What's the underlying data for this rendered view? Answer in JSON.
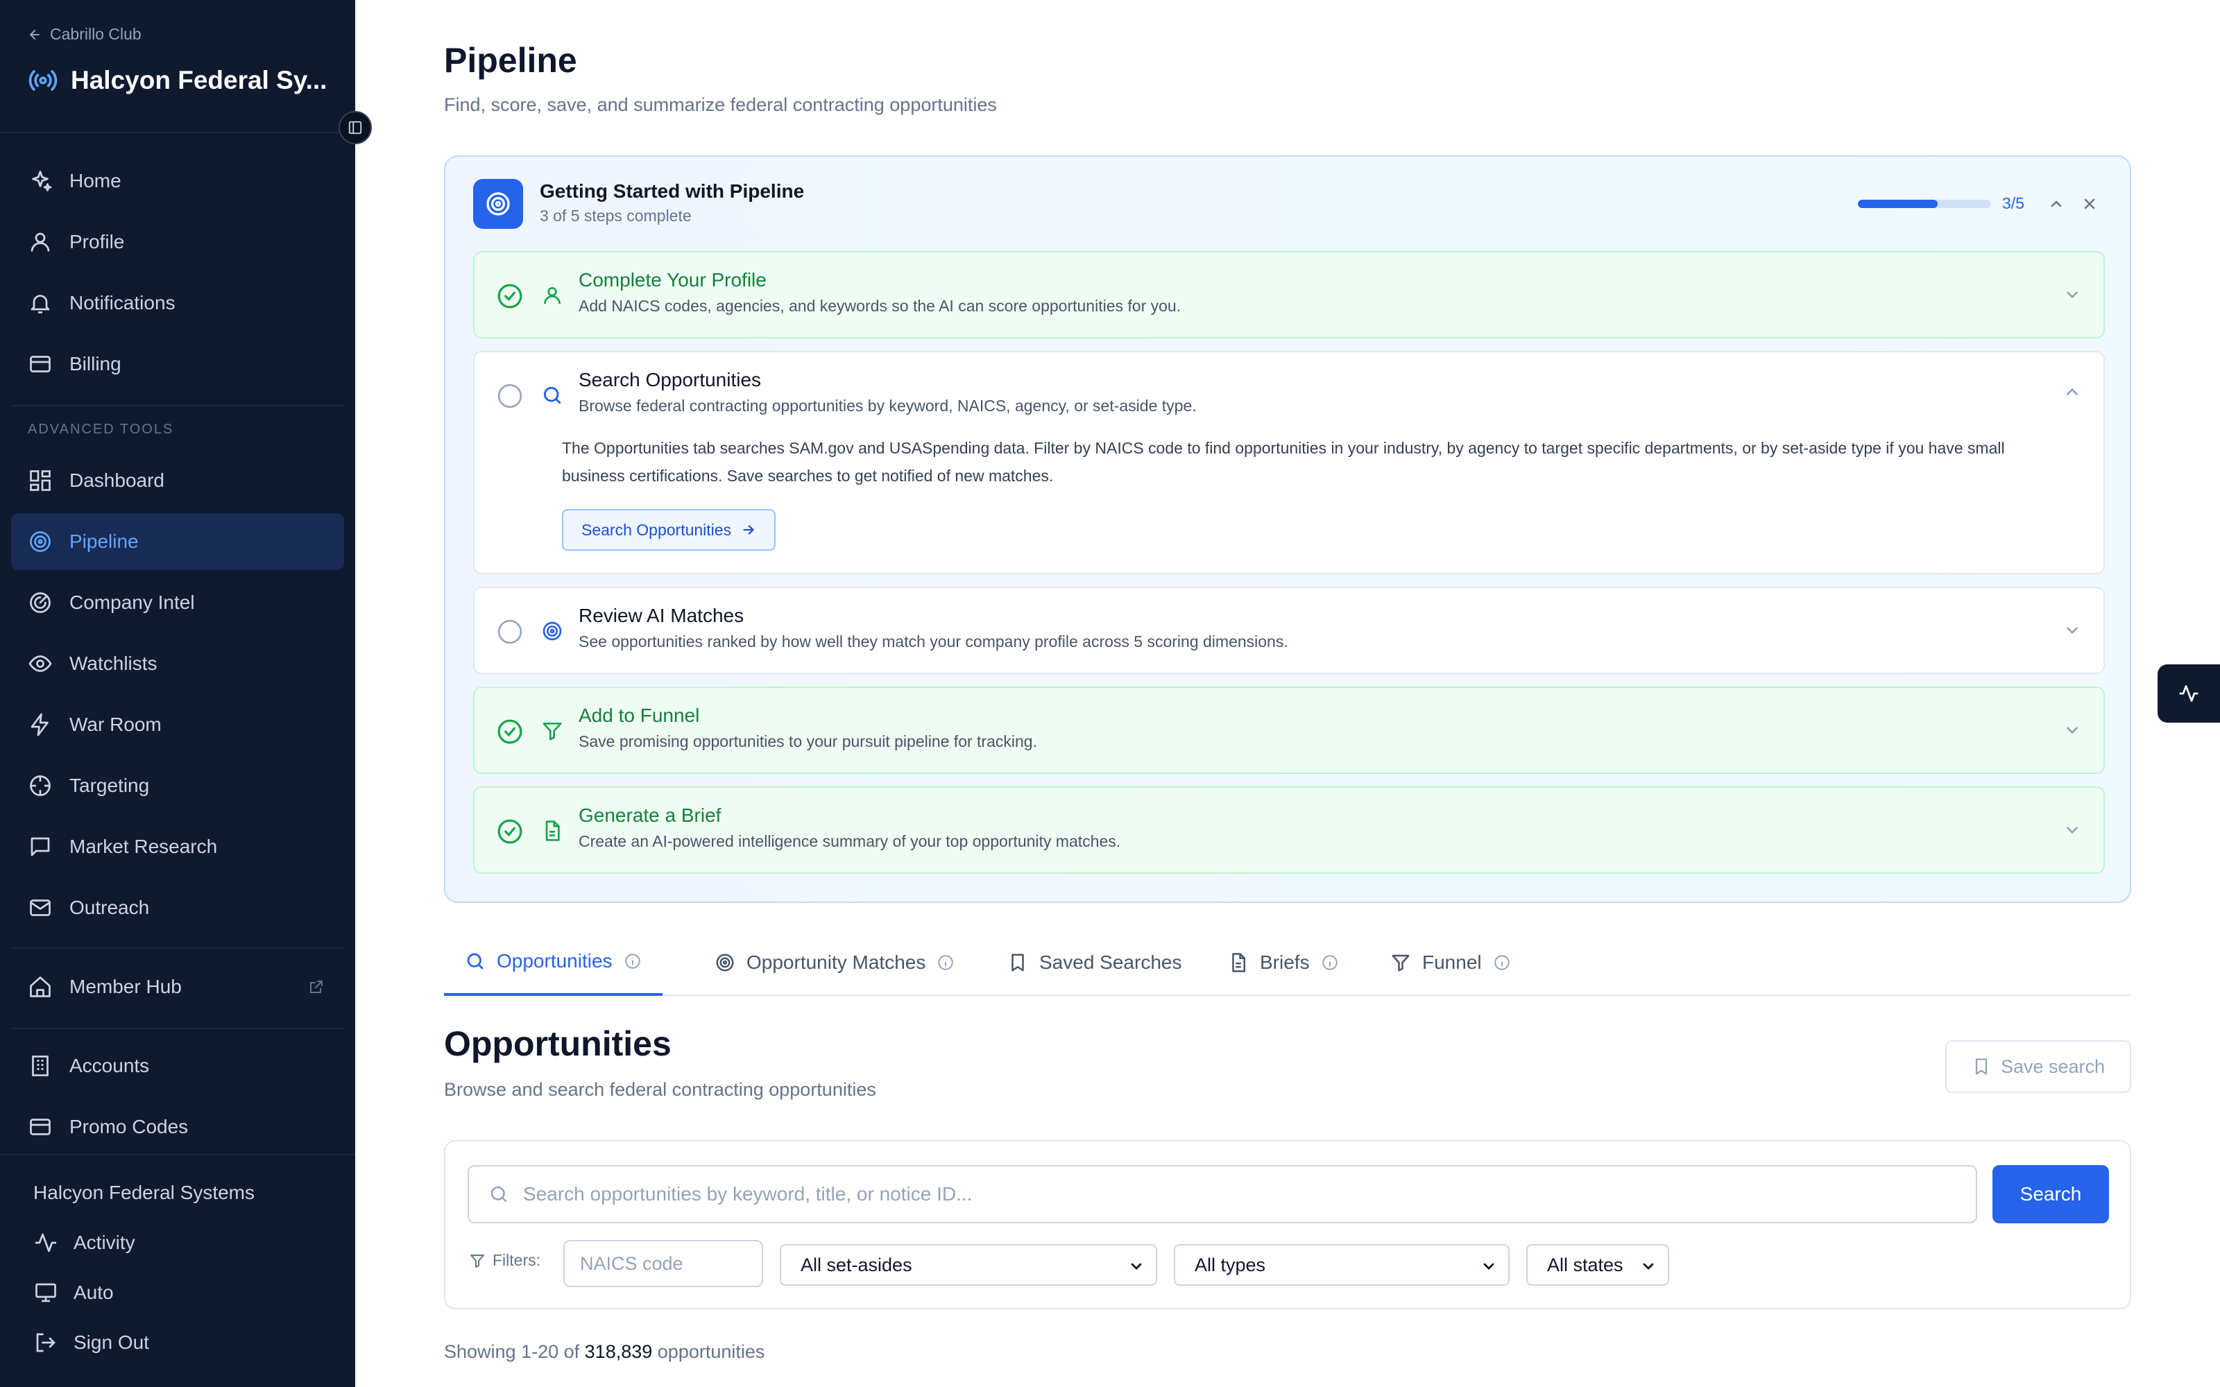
{
  "sidebar": {
    "back_label": "Cabrillo Club",
    "org_name": "Halcyon Federal Sy...",
    "primary": [
      {
        "label": "Home",
        "icon": "sparkle-icon"
      },
      {
        "label": "Profile",
        "icon": "user-icon"
      },
      {
        "label": "Notifications",
        "icon": "bell-icon"
      },
      {
        "label": "Billing",
        "icon": "credit-card-icon"
      }
    ],
    "section_label": "ADVANCED TOOLS",
    "advanced": [
      {
        "label": "Dashboard",
        "icon": "grid-icon"
      },
      {
        "label": "Pipeline",
        "icon": "target-icon",
        "active": true
      },
      {
        "label": "Company Intel",
        "icon": "radar-icon"
      },
      {
        "label": "Watchlists",
        "icon": "eye-icon"
      },
      {
        "label": "War Room",
        "icon": "lightning-icon"
      },
      {
        "label": "Targeting",
        "icon": "crosshair-icon"
      },
      {
        "label": "Market Research",
        "icon": "message-square-icon"
      },
      {
        "label": "Outreach",
        "icon": "mail-icon"
      }
    ],
    "member_hub": "Member Hub",
    "admin": [
      {
        "label": "Accounts",
        "icon": "building-icon"
      },
      {
        "label": "Promo Codes",
        "icon": "credit-card-icon"
      }
    ],
    "footer_org": "Halcyon Federal Systems",
    "footer_items": [
      {
        "label": "Activity",
        "icon": "activity-icon"
      },
      {
        "label": "Auto",
        "icon": "monitor-icon"
      },
      {
        "label": "Sign Out",
        "icon": "sign-out-icon"
      }
    ]
  },
  "page": {
    "title": "Pipeline",
    "subtitle": "Find, score, save, and summarize federal contracting opportunities"
  },
  "getting_started": {
    "title": "Getting Started with Pipeline",
    "subtitle": "3 of 5 steps complete",
    "progress_fraction": 0.6,
    "count_label": "3/5",
    "steps": [
      {
        "title": "Complete Your Profile",
        "description": "Add NAICS codes, agencies, and keywords so the AI can score opportunities for you.",
        "done": true
      },
      {
        "title": "Search Opportunities",
        "description": "Browse federal contracting opportunities by keyword, NAICS, agency, or set-aside type.",
        "done": false,
        "expanded": true,
        "body": "The Opportunities tab searches SAM.gov and USASpending data. Filter by NAICS code to find opportunities in your industry, by agency to target specific departments, or by set-aside type if you have small business certifications. Save searches to get notified of new matches.",
        "action_label": "Search Opportunities"
      },
      {
        "title": "Review AI Matches",
        "description": "See opportunities ranked by how well they match your company profile across 5 scoring dimensions.",
        "done": false
      },
      {
        "title": "Add to Funnel",
        "description": "Save promising opportunities to your pursuit pipeline for tracking.",
        "done": true
      },
      {
        "title": "Generate a Brief",
        "description": "Create an AI-powered intelligence summary of your top opportunity matches.",
        "done": true
      }
    ]
  },
  "tabs": [
    {
      "label": "Opportunities",
      "active": true
    },
    {
      "label": "Opportunity Matches"
    },
    {
      "label": "Saved Searches"
    },
    {
      "label": "Briefs"
    },
    {
      "label": "Funnel"
    }
  ],
  "opportunities": {
    "title": "Opportunities",
    "subtitle": "Browse and search federal contracting opportunities",
    "save_search_label": "Save search",
    "search_placeholder": "Search opportunities by keyword, title, or notice ID...",
    "search_button": "Search",
    "filters_label": "Filters:",
    "naics_placeholder": "NAICS code",
    "set_aside_value": "All set-asides",
    "type_value": "All types",
    "state_value": "All states",
    "showing_prefix": "Showing 1-20 of",
    "showing_count": "318,839",
    "showing_suffix": "opportunities"
  },
  "colors": {
    "accent": "#2563eb",
    "sidebar_bg": "#0f1a2e",
    "success": "#16a34a"
  }
}
